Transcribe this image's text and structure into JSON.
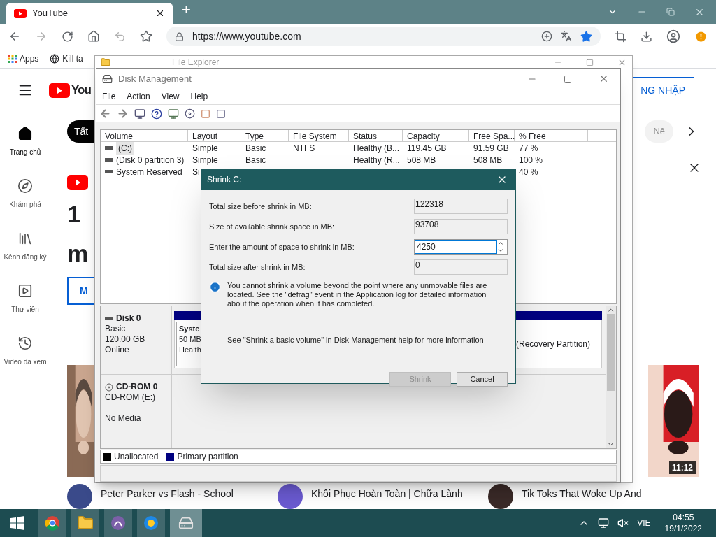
{
  "browser": {
    "tab": {
      "title": "YouTube",
      "selected": true
    },
    "new_tab": "+",
    "address": "https://www.youtube.com",
    "bookmarks": [
      {
        "kind": "apps",
        "label": "Apps"
      },
      {
        "kind": "globe",
        "label": "Kill ta"
      }
    ]
  },
  "youtube": {
    "logo": "You",
    "sign_in": "NG NHẬP",
    "sidebar": [
      {
        "kind": "home",
        "label": "Trang chủ",
        "selected": true
      },
      {
        "kind": "explore",
        "label": "Khám phá",
        "selected": false
      },
      {
        "kind": "subscriptions",
        "label": "Kênh đăng ký",
        "selected": false
      },
      {
        "kind": "library",
        "label": "Thư viện",
        "selected": false
      },
      {
        "kind": "history",
        "label": "Video đã xem",
        "selected": false
      }
    ],
    "chips": [
      {
        "label": "Tất",
        "selected": true
      },
      {
        "label": "Nê",
        "selected": false
      }
    ],
    "banner": {
      "line_1": "1",
      "line_2": "m",
      "button": "M"
    },
    "duration": "11:12",
    "videos": [
      {
        "title": "Peter Parker vs Flash - School"
      },
      {
        "title": "Khôi Phục Hoàn Toàn | Chữa Lành"
      },
      {
        "title": "Tik Toks That Woke Up And"
      }
    ]
  },
  "file_explorer": {
    "title": "File Explorer"
  },
  "disk_management": {
    "title": "Disk Management",
    "menu": [
      "File",
      "Action",
      "View",
      "Help"
    ],
    "columns": [
      "Volume",
      "Layout",
      "Type",
      "File System",
      "Status",
      "Capacity",
      "Free Spa...",
      "% Free"
    ],
    "rows": [
      {
        "selected": true,
        "cells": [
          "(C:)",
          "Simple",
          "Basic",
          "NTFS",
          "Healthy (B...",
          "119.45 GB",
          "91.59 GB",
          "77 %"
        ]
      },
      {
        "selected": false,
        "cells": [
          "(Disk 0 partition 3)",
          "Simple",
          "Basic",
          null,
          "Healthy (R...",
          "508 MB",
          "508 MB",
          "100 %"
        ]
      },
      {
        "selected": false,
        "cells": [
          "System Reserved",
          "Si",
          null,
          null,
          null,
          null,
          null,
          "40 %"
        ]
      }
    ],
    "disks": [
      {
        "kind": "disk",
        "name": "Disk 0",
        "lines": [
          "Basic",
          "120.00 GB",
          "Online"
        ],
        "partition": {
          "name": "Syste",
          "size": "50 MB",
          "status": "Health"
        },
        "recovery": "(Recovery Partition)"
      },
      {
        "kind": "cdrom",
        "name": "CD-ROM 0",
        "lines": [
          "CD-ROM (E:)",
          "No Media"
        ]
      }
    ],
    "legend": [
      {
        "label": "Unallocated",
        "color": "#000000"
      },
      {
        "label": "Primary partition",
        "color": "#000080"
      }
    ]
  },
  "dialog": {
    "title": "Shrink C:",
    "fields": [
      {
        "label": "Total size before shrink in MB:",
        "value": "122318",
        "editable": false
      },
      {
        "label": "Size of available shrink space in MB:",
        "value": "93708",
        "editable": false
      },
      {
        "label": "Enter the amount of space to shrink in MB:",
        "value": "4250",
        "editable": true
      },
      {
        "label": "Total size after shrink in MB:",
        "value": "0",
        "editable": false
      }
    ],
    "info": "You cannot shrink a volume beyond the point where any unmovable files are located. See the \"defrag\" event in the Application log for detailed information about the operation when it has completed.",
    "help": "See \"Shrink a basic volume\" in Disk Management help for more information",
    "buttons": [
      {
        "label": "Shrink",
        "disabled": true
      },
      {
        "label": "Cancel",
        "disabled": false
      }
    ]
  },
  "taskbar": {
    "apps": [
      {
        "kind": "chrome",
        "selected": false
      },
      {
        "kind": "folder",
        "selected": false
      },
      {
        "kind": "torrent",
        "selected": false
      },
      {
        "kind": "browser",
        "selected": false
      },
      {
        "kind": "disk",
        "selected": true
      }
    ],
    "language": "VIE",
    "time": "04:55",
    "date": "19/1/2022"
  }
}
